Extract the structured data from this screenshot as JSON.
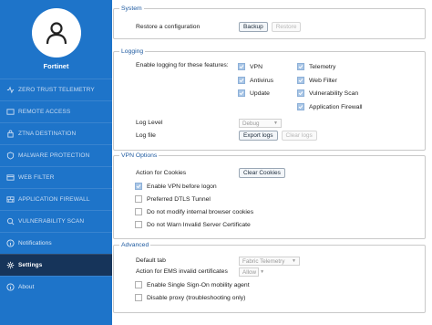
{
  "sidebar": {
    "profile_name": "Fortinet",
    "items": [
      {
        "label": "ZERO TRUST TELEMETRY",
        "icon": "telemetry-icon"
      },
      {
        "label": "REMOTE ACCESS",
        "icon": "remote-access-icon"
      },
      {
        "label": "ZTNA DESTINATION",
        "icon": "ztna-icon"
      },
      {
        "label": "MALWARE PROTECTION",
        "icon": "malware-icon"
      },
      {
        "label": "WEB FILTER",
        "icon": "web-filter-icon"
      },
      {
        "label": "APPLICATION FIREWALL",
        "icon": "firewall-icon"
      },
      {
        "label": "VULNERABILITY SCAN",
        "icon": "vulnerability-icon"
      },
      {
        "label": "Notifications",
        "icon": "info-icon"
      },
      {
        "label": "Settings",
        "icon": "gear-icon",
        "active": true
      },
      {
        "label": "About",
        "icon": "info-icon"
      }
    ]
  },
  "system": {
    "legend": "System",
    "restore_label": "Restore a configuration",
    "backup_button": "Backup",
    "restore_button": "Restore"
  },
  "logging": {
    "legend": "Logging",
    "enable_label": "Enable logging for these features:",
    "features_left": [
      {
        "label": "VPN",
        "checked": true
      },
      {
        "label": "Antivirus",
        "checked": true
      },
      {
        "label": "Update",
        "checked": true
      }
    ],
    "features_right": [
      {
        "label": "Telemetry",
        "checked": true
      },
      {
        "label": "Web Filter",
        "checked": true
      },
      {
        "label": "Vulnerability Scan",
        "checked": true
      },
      {
        "label": "Application Firewall",
        "checked": true
      }
    ],
    "log_level_label": "Log Level",
    "log_level_value": "Debug",
    "log_file_label": "Log file",
    "export_button": "Export logs",
    "clear_button": "Clear logs"
  },
  "vpn": {
    "legend": "VPN Options",
    "cookies_label": "Action for Cookies",
    "clear_cookies_button": "Clear Cookies",
    "options": [
      {
        "label": "Enable VPN before logon",
        "checked": true
      },
      {
        "label": "Preferred DTLS Tunnel",
        "checked": false
      },
      {
        "label": "Do not modify internal browser cookies",
        "checked": false
      },
      {
        "label": "Do not Warn Invalid Server Certificate",
        "checked": false
      }
    ]
  },
  "advanced": {
    "legend": "Advanced",
    "default_tab_label": "Default tab",
    "default_tab_value": "Fabric Telemetry",
    "ems_label": "Action for EMS invalid certificates",
    "ems_value": "Allow",
    "options": [
      {
        "label": "Enable Single Sign-On mobility agent",
        "checked": false
      },
      {
        "label": "Disable proxy (troubleshooting only)",
        "checked": false
      }
    ]
  },
  "colors": {
    "sidebar_bg": "#1e74c9",
    "sidebar_active": "#16345a",
    "legend_text": "#1e5aa0"
  }
}
